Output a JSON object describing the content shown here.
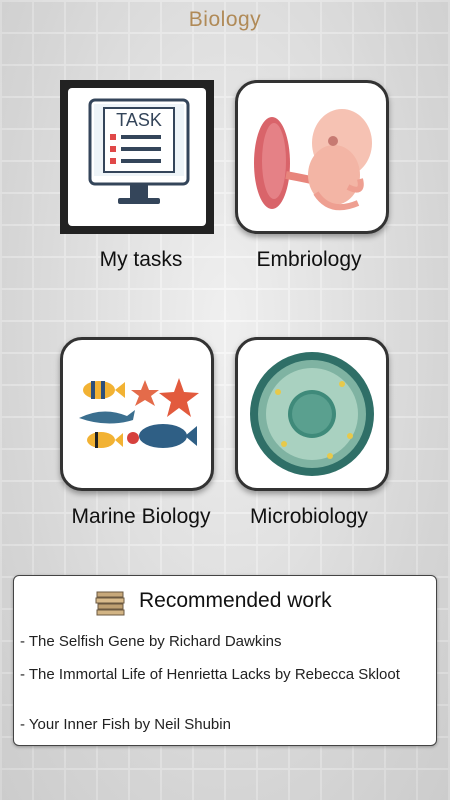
{
  "app": {
    "title": "Biology"
  },
  "tiles": [
    {
      "label": "My tasks",
      "icon": "task-monitor-icon",
      "screen_text": "TASK"
    },
    {
      "label": "Embriology",
      "icon": "embryo-icon"
    },
    {
      "label": "Marine Biology",
      "icon": "marine-life-icon"
    },
    {
      "label": "Microbiology",
      "icon": "cell-icon"
    }
  ],
  "recommended": {
    "title": "Recommended work",
    "icon": "books-icon",
    "items": [
      "- The Selfish Gene by Richard Dawkins",
      "- The Immortal Life of Henrietta Lacks by Rebecca Skloot",
      "- Your Inner Fish by Neil Shubin"
    ]
  },
  "colors": {
    "title": "#b08a57",
    "tile_border": "#333333"
  }
}
